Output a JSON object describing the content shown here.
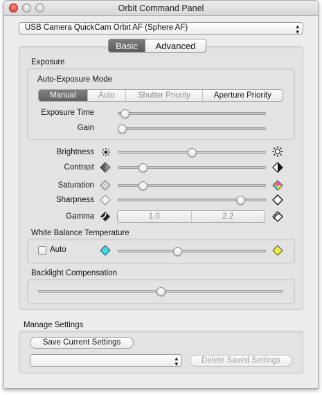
{
  "window": {
    "title": "Orbit Command Panel"
  },
  "camera_select": {
    "value": "USB Camera QuickCam Orbit AF (Sphere AF)"
  },
  "tabs": [
    {
      "label": "Basic",
      "active": true
    },
    {
      "label": "Advanced",
      "active": false
    }
  ],
  "exposure": {
    "heading": "Exposure",
    "mode_label": "Auto-Exposure Mode",
    "modes": [
      {
        "label": "Manual",
        "selected": true
      },
      {
        "label": "Auto",
        "selected": false
      },
      {
        "label": "Shutter Priority",
        "selected": false
      },
      {
        "label": "Aperture Priority",
        "selected": false
      }
    ],
    "exposure_time_label": "Exposure Time",
    "exposure_time_level": 0.02,
    "gain_label": "Gain",
    "gain_level": 0.0
  },
  "image": {
    "brightness": {
      "label": "Brightness",
      "level": 0.5
    },
    "contrast": {
      "label": "Contrast",
      "level": 0.15
    },
    "saturation": {
      "label": "Saturation",
      "level": 0.15
    },
    "sharpness": {
      "label": "Sharpness",
      "level": 0.85
    },
    "gamma": {
      "label": "Gamma",
      "values": [
        "1.0",
        "2.2"
      ]
    }
  },
  "white_balance": {
    "heading": "White Balance Temperature",
    "auto_label": "Auto",
    "auto_checked": false,
    "level": 0.4
  },
  "backlight": {
    "heading": "Backlight Compensation",
    "level": 0.5
  },
  "manage": {
    "heading": "Manage Settings",
    "save_label": "Save Current Settings",
    "saved_select_value": "",
    "delete_label": "Delete Saved Settings"
  },
  "icons": {
    "brightness_low": "sun-small-icon",
    "brightness_high": "sun-large-icon",
    "contrast_low": "contrast-low-icon",
    "contrast_high": "contrast-high-icon",
    "saturation_low": "saturation-low-icon",
    "saturation_high": "saturation-high-icon",
    "sharpness_low": "sharpness-low-icon",
    "sharpness_high": "sharpness-high-icon",
    "gamma_low": "gamma-low-icon",
    "gamma_high": "gamma-high-icon",
    "wb_cool": "cyan-diamond-icon",
    "wb_warm": "yellow-diamond-icon"
  },
  "colors": {
    "wb_cool": "#29e0f0",
    "wb_warm": "#f3ef2a",
    "selected_segment": "#6c6c6c"
  }
}
